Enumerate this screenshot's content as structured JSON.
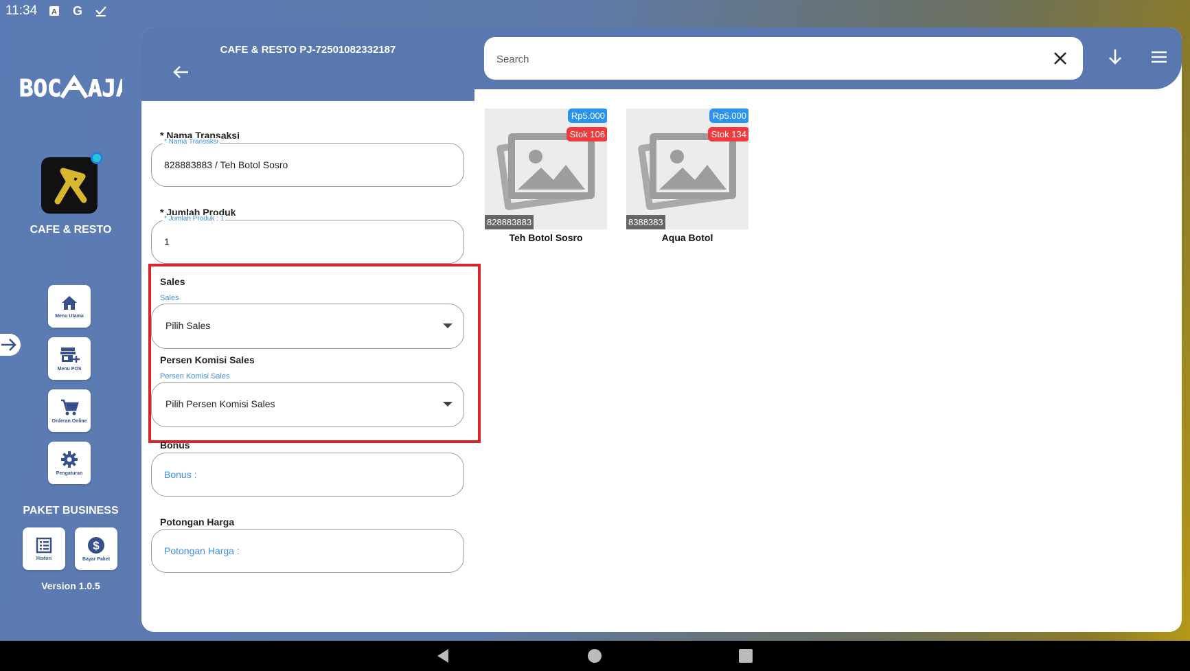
{
  "status_bar": {
    "time": "11:34",
    "icons": [
      "a-icon",
      "google-icon",
      "check-icon"
    ]
  },
  "sidebar": {
    "brand_logo_text": "BOC AJA",
    "app_name": "CAFE & RESTO",
    "tiles": [
      {
        "label": "Menu Utama",
        "icon": "home-icon"
      },
      {
        "label": "Menu POS",
        "icon": "store-add-icon"
      },
      {
        "label": "Orderan Online",
        "icon": "cart-icon"
      },
      {
        "label": "Pengaturan",
        "icon": "gear-icon"
      }
    ],
    "package_title": "PAKET BUSINESS",
    "package_tiles": [
      {
        "label": "Histori",
        "icon": "list-icon"
      },
      {
        "label": "Bayar Paket",
        "icon": "dollar-icon"
      }
    ],
    "version": "Version 1.0.5"
  },
  "header": {
    "title": "CAFE & RESTO PJ-72501082332187",
    "search_placeholder": "Search"
  },
  "form": {
    "nama_transaksi": {
      "label": "* Nama Transaksi",
      "float": "* Nama Transaksi",
      "value": "828883883 / Teh Botol Sosro"
    },
    "jumlah_produk": {
      "label": "* Jumlah Produk",
      "float": "* Jumlah Produk : 1",
      "value": "1"
    },
    "sales": {
      "label": "Sales",
      "float": "Sales",
      "value": "Pilih Sales"
    },
    "persen_komisi": {
      "label": "Persen Komisi Sales",
      "float": "Persen Komisi Sales",
      "value": "Pilih Persen Komisi Sales"
    },
    "bonus": {
      "label": "Bonus",
      "placeholder": "Bonus :"
    },
    "potongan": {
      "label": "Potongan Harga",
      "placeholder": "Potongan Harga :"
    }
  },
  "products": [
    {
      "name": "Teh Botol Sosro",
      "price": "Rp5.000",
      "stock": "Stok 106",
      "code": "828883883"
    },
    {
      "name": "Aqua Botol",
      "price": "Rp5.000",
      "stock": "Stok 134",
      "code": "8388383"
    }
  ],
  "colors": {
    "header": "#5978b0",
    "price_badge": "#2a93f0",
    "stock_badge": "#ef3b3b",
    "highlight": "#d9262c",
    "float_label": "#3d8ee0"
  }
}
